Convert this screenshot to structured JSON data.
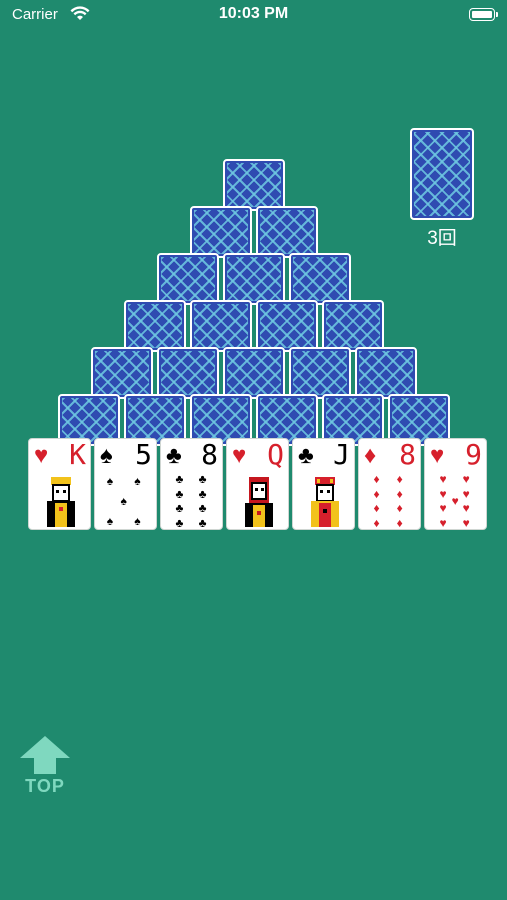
{
  "status_bar": {
    "carrier": "Carrier",
    "time": "10:03 PM"
  },
  "deck": {
    "count_label": "3回"
  },
  "pyramid": {
    "rows": [
      1,
      2,
      3,
      4,
      5,
      6
    ]
  },
  "bottom_row": [
    {
      "suit": "♥",
      "rank": "K",
      "color": "red",
      "kind": "face",
      "figure": "king"
    },
    {
      "suit": "♠",
      "rank": "5",
      "color": "black",
      "kind": "pips",
      "count": 5
    },
    {
      "suit": "♣",
      "rank": "8",
      "color": "black",
      "kind": "pips",
      "count": 8
    },
    {
      "suit": "♥",
      "rank": "Q",
      "color": "red",
      "kind": "face",
      "figure": "queen"
    },
    {
      "suit": "♣",
      "rank": "J",
      "color": "black",
      "kind": "face",
      "figure": "jack"
    },
    {
      "suit": "♦",
      "rank": "8",
      "color": "red",
      "kind": "pips",
      "count": 8
    },
    {
      "suit": "♥",
      "rank": "9",
      "color": "red",
      "kind": "pips",
      "count": 9
    }
  ],
  "top_button": {
    "label": "TOP",
    "icon": "up-arrow-icon"
  },
  "colors": {
    "table": "#1f8a6e",
    "card_back": "#2f4bb1",
    "red_suit": "#d6202c"
  }
}
